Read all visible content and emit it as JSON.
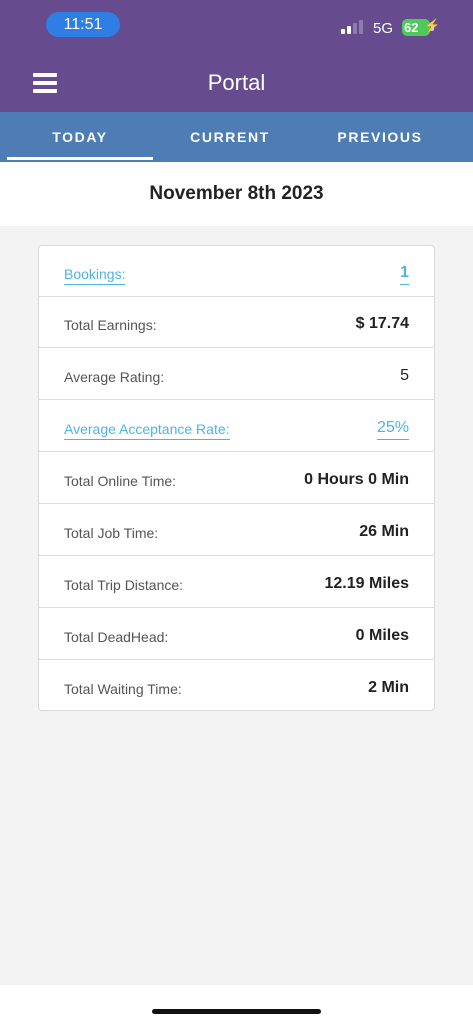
{
  "status_bar": {
    "time": "11:51",
    "network": "5G",
    "battery": "62"
  },
  "header": {
    "title": "Portal"
  },
  "tabs": [
    {
      "label": "TODAY",
      "active": true
    },
    {
      "label": "CURRENT",
      "active": false
    },
    {
      "label": "PREVIOUS",
      "active": false
    }
  ],
  "date": "November 8th 2023",
  "stats": [
    {
      "label": "Bookings:",
      "value": "1",
      "link": true
    },
    {
      "label": "Total Earnings:",
      "value": "$ 17.74",
      "link": false
    },
    {
      "label": "Average Rating:",
      "value": "5",
      "link": false
    },
    {
      "label": "Average Acceptance Rate:",
      "value": "25%",
      "link": true
    },
    {
      "label": "Total Online Time:",
      "value": "0 Hours 0 Min",
      "link": false
    },
    {
      "label": "Total Job Time:",
      "value": "26 Min",
      "link": false
    },
    {
      "label": "Total Trip Distance:",
      "value": "12.19 Miles",
      "link": false
    },
    {
      "label": "Total DeadHead:",
      "value": "0 Miles",
      "link": false
    },
    {
      "label": "Total Waiting Time:",
      "value": "2 Min",
      "link": false
    }
  ],
  "colors": {
    "header_purple": "#674b8f",
    "tab_blue": "#4e7cb4",
    "link_blue": "#4db3e6"
  }
}
